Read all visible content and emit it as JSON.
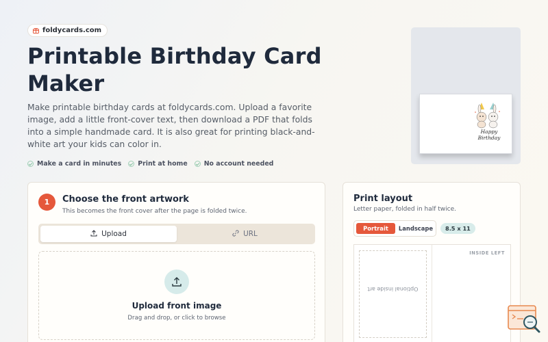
{
  "site": {
    "badge": "foldycards.com"
  },
  "hero": {
    "title": "Printable Birthday Card Maker",
    "description": "Make printable birthday cards at foldycards.com. Upload a favorite image, add a little front-cover text, then download a PDF that folds into a simple handmade card. It is also great for printing black-and-white art your kids can color in.",
    "features": [
      "Make a card in minutes",
      "Print at home",
      "No account needed"
    ]
  },
  "preview": {
    "card_text_1": "Happy",
    "card_text_2": "Birthday"
  },
  "step1": {
    "number": "1",
    "title": "Choose the front artwork",
    "subtitle": "This becomes the front cover after the page is folded twice.",
    "tabs": {
      "upload": "Upload",
      "url": "URL"
    },
    "dropzone": {
      "title": "Upload front image",
      "subtitle": "Drag and drop, or click to browse"
    }
  },
  "print_layout": {
    "title": "Print layout",
    "subtitle": "Letter paper, folded in half twice.",
    "orientation": {
      "portrait": "Portrait",
      "landscape": "Landscape",
      "selected": "Portrait"
    },
    "paper_size": "8.5 x 11",
    "inside_left_label": "INSIDE LEFT",
    "inside_art_label": "Optional inside art"
  },
  "colors": {
    "accent": "#e5583b",
    "teal_chip": "#d8ecea",
    "title": "#1f2a3c"
  },
  "icons": [
    "gift-icon",
    "check-circle-icon",
    "upload-icon",
    "link-icon",
    "upload-tray-icon",
    "search-code-icon"
  ]
}
